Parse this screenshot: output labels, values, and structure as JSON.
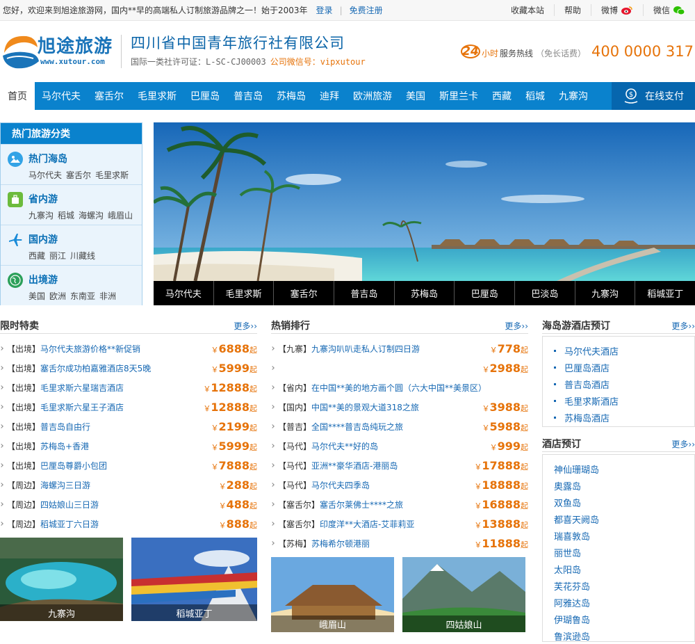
{
  "topbar": {
    "welcome": "您好，欢迎来到旭途旅游网，国内**早的高端私人订制旅游品牌之一！始于2003年",
    "login": "登录",
    "register": "免费注册",
    "links": [
      "收藏本站",
      "帮助",
      "微博",
      "微信"
    ]
  },
  "header": {
    "logo_text": "旭途旅游",
    "logo_url": "www.xutour.com",
    "company": "四川省中国青年旅行社有限公司",
    "license": "国际一类社许可证：L-SC-CJ00003",
    "wechat_label": "公司微信号：vipxutour",
    "hotline_24": "24",
    "hotline_hrs": "小时",
    "hotline_label": "服务热线",
    "hotline_free": "（免长话费）",
    "hotline_number": "400 0000 317"
  },
  "nav": {
    "items": [
      "首页",
      "马尔代夫",
      "塞舌尔",
      "毛里求斯",
      "巴厘岛",
      "普吉岛",
      "苏梅岛",
      "迪拜",
      "欧洲旅游",
      "美国",
      "斯里兰卡",
      "西藏",
      "稻城",
      "九寨沟"
    ],
    "pay": "在线支付"
  },
  "sidebar": {
    "title": "热门旅游分类",
    "cats": [
      {
        "name": "热门海岛",
        "subs": [
          "马尔代夫",
          "塞舌尔",
          "毛里求斯"
        ],
        "icon": "island-icon"
      },
      {
        "name": "省内游",
        "subs": [
          "九寨沟",
          "稻城",
          "海螺沟",
          "峨眉山"
        ],
        "icon": "bag-icon"
      },
      {
        "name": "国内游",
        "subs": [
          "西藏",
          "丽江",
          "川藏线"
        ],
        "icon": "plane-icon"
      },
      {
        "name": "出境游",
        "subs": [
          "美国",
          "欧洲",
          "东南亚",
          "非洲"
        ],
        "icon": "globe-icon"
      }
    ]
  },
  "banner": {
    "tabs": [
      "马尔代夫",
      "毛里求斯",
      "塞舌尔",
      "普吉岛",
      "苏梅岛",
      "巴厘岛",
      "巴淡岛",
      "九寨沟",
      "稻城亚丁"
    ]
  },
  "sale": {
    "title": "限时特卖",
    "more": "更多",
    "items": [
      {
        "tag": "【出境】",
        "name": "马尔代夫旅游价格**新促销",
        "price": "6888"
      },
      {
        "tag": "【出境】",
        "name": " 塞舌尔成功柏嘉雅酒店8天5晚",
        "price": "5999"
      },
      {
        "tag": "【出境】",
        "name": "毛里求斯六星瑞吉酒店",
        "price": "12888"
      },
      {
        "tag": "【出境】",
        "name": "毛里求斯六星王子酒店",
        "price": "12888"
      },
      {
        "tag": "【出境】",
        "name": "普吉岛自由行",
        "price": "2199"
      },
      {
        "tag": "【出境】",
        "name": "苏梅岛+香港",
        "price": "5999"
      },
      {
        "tag": "【出境】",
        "name": "巴厘岛尊爵小包团",
        "price": "7888"
      },
      {
        "tag": "【周边】",
        "name": "海螺沟三日游",
        "price": "288"
      },
      {
        "tag": "【周边】",
        "name": "四姑娘山三日游",
        "price": "488"
      },
      {
        "tag": "【周边】",
        "name": "稻城亚丁六日游",
        "price": "888"
      }
    ],
    "photos": [
      "九寨沟",
      "稻城亚丁"
    ]
  },
  "hot": {
    "title": "热销排行",
    "more": "更多",
    "items": [
      {
        "tag": "【九寨】",
        "name": "九寨沟叭叭走私人订制四日游",
        "price": "778"
      },
      {
        "tag": "",
        "name": "",
        "price": "2988"
      },
      {
        "tag": "【省内】",
        "name": "在中国**美的地方画个圆（六大中国**美景区）",
        "price": ""
      },
      {
        "tag": "【国内】",
        "name": "中国**美的景观大道318之旅",
        "price": "3988"
      },
      {
        "tag": "【普吉】",
        "name": "全国****普吉岛纯玩之旅",
        "price": "5988"
      },
      {
        "tag": "【马代】",
        "name": "马尔代夫**好的岛",
        "price": "999"
      },
      {
        "tag": "【马代】",
        "name": "亚洲**豪华酒店-港丽岛",
        "price": "17888"
      },
      {
        "tag": "【马代】",
        "name": "马尔代夫四季岛",
        "price": "18888"
      },
      {
        "tag": "【塞舌尔】",
        "name": "塞舌尔莱佛士****之旅",
        "price": "16888"
      },
      {
        "tag": "【塞舌尔】",
        "name": "印度洋**大酒店-艾菲莉亚",
        "price": "13888"
      },
      {
        "tag": "【苏梅】",
        "name": "苏梅希尔顿港丽",
        "price": "11888"
      }
    ],
    "photos": [
      "峨眉山",
      "四姑娘山"
    ]
  },
  "island_hotels": {
    "title": "海岛游酒店预订",
    "more": "更多",
    "items": [
      "马尔代夫酒店",
      "巴厘岛酒店",
      "普吉岛酒店",
      "毛里求斯酒店",
      "苏梅岛酒店"
    ]
  },
  "hotels": {
    "title": "酒店预订",
    "more": "更多",
    "items": [
      "神仙珊瑚岛",
      "奥露岛",
      "双鱼岛",
      "都喜天阙岛",
      "瑞喜敦岛",
      "丽世岛",
      "太阳岛",
      "芙花芬岛",
      "阿雅达岛",
      "伊瑚鲁岛",
      "鲁滨逊岛"
    ]
  },
  "price_prefix": "￥",
  "price_suffix": "起",
  "more_arrows": "››"
}
